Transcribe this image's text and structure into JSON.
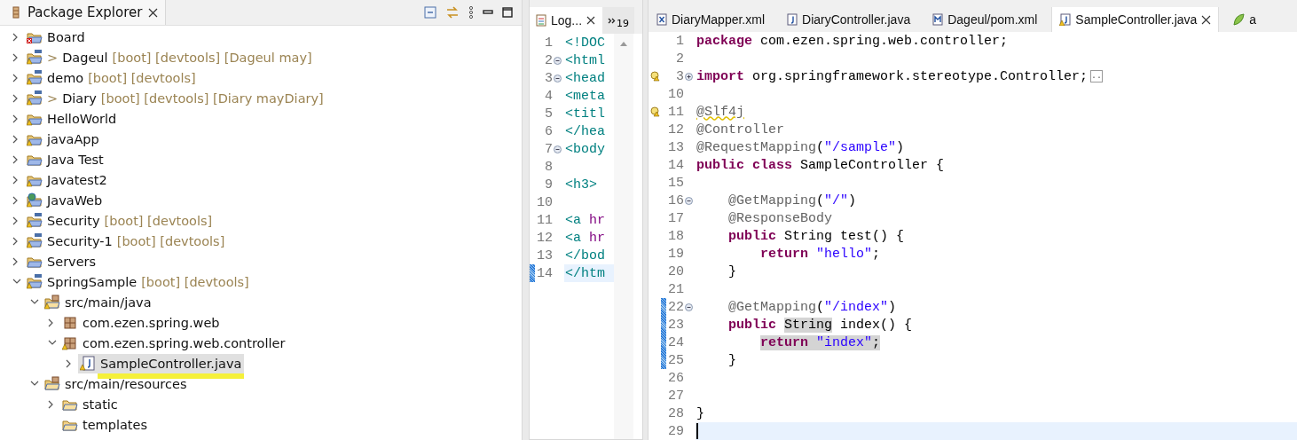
{
  "explorer": {
    "title": "Package Explorer",
    "tree": [
      {
        "kind": "project",
        "error": true,
        "label": "Board",
        "expanded": false,
        "selected": false
      },
      {
        "kind": "maven_project",
        "warning": true,
        "prefix": ">",
        "label": "Dageul",
        "decoration": "[boot] [devtools] [Dageul may]",
        "expanded": false,
        "selected": false
      },
      {
        "kind": "maven_project",
        "warning": true,
        "label": "demo",
        "decoration": "[boot] [devtools]",
        "expanded": false,
        "selected": false
      },
      {
        "kind": "maven_project",
        "warning": true,
        "prefix": ">",
        "label": "Diary",
        "decoration": "[boot] [devtools] [Diary mayDiary]",
        "expanded": false,
        "selected": false
      },
      {
        "kind": "project",
        "warning": true,
        "label": "HelloWorld",
        "expanded": false,
        "selected": false
      },
      {
        "kind": "project",
        "warning": true,
        "label": "javaApp",
        "expanded": false,
        "selected": false
      },
      {
        "kind": "project",
        "warning": false,
        "label": "Java Test",
        "expanded": false,
        "selected": false
      },
      {
        "kind": "project",
        "warning": true,
        "label": "Javatest2",
        "expanded": false,
        "selected": false
      },
      {
        "kind": "web_project",
        "warning": true,
        "label": "JavaWeb",
        "expanded": false,
        "selected": false
      },
      {
        "kind": "maven_project",
        "warning": true,
        "label": "Security",
        "decoration": "[boot] [devtools]",
        "expanded": false,
        "selected": false
      },
      {
        "kind": "maven_project",
        "warning": true,
        "label": "Security-1",
        "decoration": "[boot] [devtools]",
        "expanded": false,
        "selected": false
      },
      {
        "kind": "project",
        "warning": false,
        "label": "Servers",
        "expanded": false,
        "selected": false
      },
      {
        "kind": "maven_project",
        "warning": true,
        "label": "SpringSample",
        "decoration": "[boot] [devtools]",
        "expanded": true,
        "selected": false,
        "children": [
          {
            "kind": "source_folder",
            "warning": true,
            "label": "src/main/java",
            "expanded": true,
            "selected": false,
            "children": [
              {
                "kind": "package",
                "warning": false,
                "label": "com.ezen.spring.web",
                "expanded": false,
                "selected": false
              },
              {
                "kind": "package",
                "warning": true,
                "label": "com.ezen.spring.web.controller",
                "expanded": true,
                "selected": false,
                "children": [
                  {
                    "kind": "java_file",
                    "warning": true,
                    "label": "SampleController.java",
                    "expanded": false,
                    "selected": true,
                    "marked": true
                  }
                ]
              }
            ]
          },
          {
            "kind": "source_folder",
            "warning": false,
            "label": "src/main/resources",
            "expanded": true,
            "selected": false,
            "children": [
              {
                "kind": "folder",
                "warning": false,
                "label": "static",
                "expanded": false,
                "selected": false
              },
              {
                "kind": "folder",
                "warning": false,
                "label": "templates",
                "selected": false
              }
            ]
          }
        ]
      }
    ]
  },
  "side_editor": {
    "tab": {
      "label": "Log...",
      "selected": true
    },
    "overflow_count": "19",
    "lines": [
      {
        "number": "1",
        "tokens": [
          {
            "kind": "tag",
            "text": "<!DOC"
          }
        ]
      },
      {
        "number": "2",
        "folded": false,
        "tokens": [
          {
            "kind": "tag",
            "text": "<html"
          }
        ]
      },
      {
        "number": "3",
        "folded": false,
        "tokens": [
          {
            "kind": "tag",
            "text": "<head"
          }
        ]
      },
      {
        "number": "4",
        "tokens": [
          {
            "kind": "tag",
            "text": "<meta"
          }
        ]
      },
      {
        "number": "5",
        "tokens": [
          {
            "kind": "tag",
            "text": "<titl"
          }
        ]
      },
      {
        "number": "6",
        "tokens": [
          {
            "kind": "tag",
            "text": "</hea"
          }
        ]
      },
      {
        "number": "7",
        "folded": false,
        "tokens": [
          {
            "kind": "tag",
            "text": "<body"
          }
        ]
      },
      {
        "number": "8"
      },
      {
        "number": "9",
        "tokens": [
          {
            "kind": "tag",
            "text": "<h3>"
          }
        ]
      },
      {
        "number": "10"
      },
      {
        "number": "11",
        "tokens": [
          {
            "kind": "tag",
            "text": "<a "
          },
          {
            "kind": "attr",
            "text": "hr"
          }
        ]
      },
      {
        "number": "12",
        "tokens": [
          {
            "kind": "tag",
            "text": "<a "
          },
          {
            "kind": "attr",
            "text": "hr"
          }
        ]
      },
      {
        "number": "13",
        "tokens": [
          {
            "kind": "tag",
            "text": "</bod"
          }
        ]
      },
      {
        "number": "14",
        "changed": true,
        "current": true,
        "tokens": [
          {
            "kind": "tag",
            "text": "</htm"
          }
        ]
      }
    ]
  },
  "editor": {
    "tabs": [
      {
        "kind": "xml",
        "label": "DiaryMapper.xml",
        "selected": false
      },
      {
        "kind": "java",
        "label": "DiaryController.java",
        "selected": false
      },
      {
        "kind": "maven",
        "label": "Dageul/pom.xml",
        "selected": false
      },
      {
        "kind": "java_warning",
        "label": "SampleController.java",
        "selected": true
      },
      {
        "kind": "leaf",
        "label": "a",
        "selected": false
      }
    ],
    "lines": [
      {
        "number": "1",
        "tokens": [
          {
            "kind": "keyword",
            "text": "package"
          },
          {
            "kind": "plain",
            "text": " com.ezen.spring.web.controller;"
          }
        ]
      },
      {
        "number": "2"
      },
      {
        "number": "3",
        "warning": true,
        "folded": true,
        "tokens": [
          {
            "kind": "keyword",
            "text": "import"
          },
          {
            "kind": "plain",
            "text": " org.springframework.stereotype.Controller;"
          },
          {
            "kind": "folded",
            "text": ".."
          }
        ]
      },
      {
        "number": "10"
      },
      {
        "number": "11",
        "warning": true,
        "tokens": [
          {
            "kind": "annotation",
            "text": "@Slf4j",
            "squiggle": true
          }
        ]
      },
      {
        "number": "12",
        "tokens": [
          {
            "kind": "annotation",
            "text": "@Controller"
          }
        ]
      },
      {
        "number": "13",
        "tokens": [
          {
            "kind": "annotation",
            "text": "@RequestMapping"
          },
          {
            "kind": "plain",
            "text": "("
          },
          {
            "kind": "string",
            "text": "\"/sample\""
          },
          {
            "kind": "plain",
            "text": ")"
          }
        ]
      },
      {
        "number": "14",
        "tokens": [
          {
            "kind": "keyword",
            "text": "public class"
          },
          {
            "kind": "plain",
            "text": " SampleController {"
          }
        ]
      },
      {
        "number": "15"
      },
      {
        "number": "16",
        "folded": false,
        "tokens": [
          {
            "kind": "annotation",
            "text": "    @GetMapping"
          },
          {
            "kind": "plain",
            "text": "("
          },
          {
            "kind": "string",
            "text": "\"/\""
          },
          {
            "kind": "plain",
            "text": ")"
          }
        ]
      },
      {
        "number": "17",
        "tokens": [
          {
            "kind": "annotation",
            "text": "    @ResponseBody"
          }
        ]
      },
      {
        "number": "18",
        "tokens": [
          {
            "kind": "keyword",
            "text": "    public"
          },
          {
            "kind": "plain",
            "text": " String test() {"
          }
        ]
      },
      {
        "number": "19",
        "tokens": [
          {
            "kind": "keyword",
            "text": "        return"
          },
          {
            "kind": "string",
            "text": " \"hello\""
          },
          {
            "kind": "plain",
            "text": ";"
          }
        ]
      },
      {
        "number": "20",
        "tokens": [
          {
            "kind": "plain",
            "text": "    }"
          }
        ]
      },
      {
        "number": "21"
      },
      {
        "number": "22",
        "changed": true,
        "folded": false,
        "tokens": [
          {
            "kind": "annotation",
            "text": "    @GetMapping"
          },
          {
            "kind": "plain",
            "text": "("
          },
          {
            "kind": "string",
            "text": "\"/index\""
          },
          {
            "kind": "plain",
            "text": ")"
          }
        ]
      },
      {
        "number": "23",
        "changed": true,
        "tokens": [
          {
            "kind": "keyword",
            "text": "    public "
          },
          {
            "kind": "plain",
            "text": "String",
            "highlight": true
          },
          {
            "kind": "plain",
            "text": " index() {"
          }
        ]
      },
      {
        "number": "24",
        "changed": true,
        "tokens": [
          {
            "kind": "keyword",
            "text": "        return",
            "highlight": true
          },
          {
            "kind": "string",
            "text": " \"index\"",
            "highlight": true
          },
          {
            "kind": "plain",
            "text": ";",
            "highlight": true
          }
        ]
      },
      {
        "number": "25",
        "changed": true,
        "tokens": [
          {
            "kind": "plain",
            "text": "    }"
          }
        ]
      },
      {
        "number": "26"
      },
      {
        "number": "27"
      },
      {
        "number": "28",
        "tokens": [
          {
            "kind": "plain",
            "text": "}"
          }
        ]
      },
      {
        "number": "29",
        "current": true
      }
    ]
  }
}
